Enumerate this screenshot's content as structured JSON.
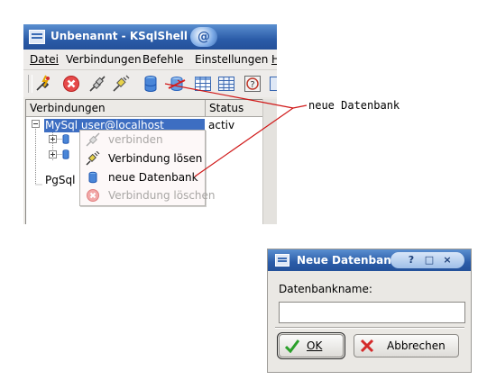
{
  "main_window": {
    "title": "Unbenannt - KSqlShell",
    "menu": [
      {
        "label": "Datei"
      },
      {
        "label": "Verbindungen"
      },
      {
        "label": "Befehle"
      },
      {
        "label": "Einstellungen"
      },
      {
        "label": "H"
      }
    ],
    "tree": {
      "columns": [
        "Verbindungen",
        "Status"
      ],
      "rows": [
        {
          "label": "MySql user@localhost",
          "status": "activ",
          "selected": true
        },
        {
          "label": "PgSql",
          "status": ""
        }
      ]
    },
    "context_menu": [
      {
        "label": "verbinden",
        "icon": "connect-plug-icon",
        "enabled": false
      },
      {
        "label": "Verbindung lösen",
        "icon": "disconnect-plug-icon",
        "enabled": true
      },
      {
        "label": "neue Datenbank",
        "icon": "database-icon",
        "enabled": true
      },
      {
        "label": "Verbindung löschen",
        "icon": "delete-connection-icon",
        "enabled": false
      }
    ]
  },
  "callout": {
    "text": "neue Datenbank"
  },
  "dialog": {
    "title": "Neue Datenbank -",
    "controls": [
      "?",
      "□",
      "×"
    ],
    "field_label": "Datenbankname:",
    "field_value": "",
    "ok_label": "OK",
    "cancel_label": "Abbrechen"
  },
  "colors": {
    "titlebar": "#2b5ca8",
    "selection": "#3d6ec2",
    "menu_bg": "#fdf8f8"
  }
}
